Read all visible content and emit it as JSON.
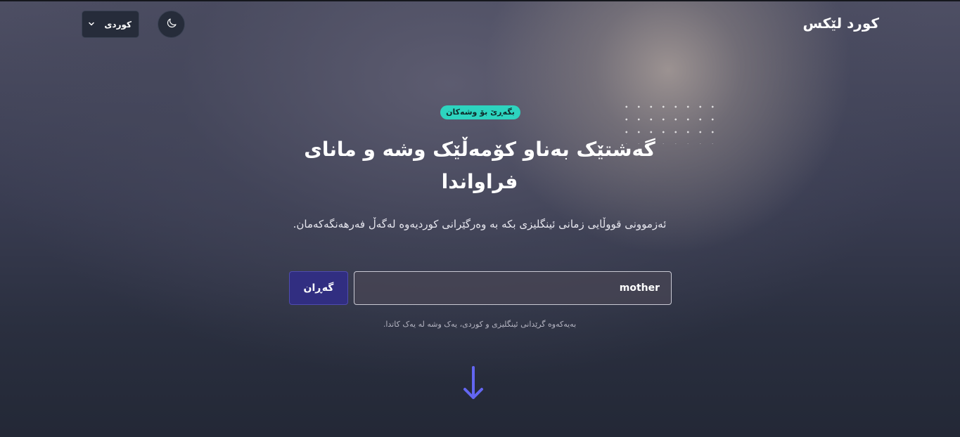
{
  "header": {
    "brand": "کورد لێکس",
    "language_select": {
      "selected": "کوردی",
      "icon": "chevron-down-icon"
    },
    "theme_toggle": {
      "icon": "moon-icon"
    }
  },
  "hero": {
    "badge": "بگەڕێ بۆ وشەکان",
    "headline_line1": "گەشتێک بەناو کۆمەڵێک وشە و مانای",
    "headline_line2": "فراواندا",
    "subtitle": "ئەزموونی قووڵایی زمانی ئینگلیزی بکە بە وەرگێرانی کوردیەوە لەگەڵ فەرهەنگەکەمان."
  },
  "search": {
    "value": "mother",
    "button_label": "گەڕان",
    "hint": "بەیەکەوە گرێدانی ئینگلیزی و کوردی، یەک وشە لە یەک کاتدا."
  },
  "scroll": {
    "icon": "arrow-down-icon"
  },
  "colors": {
    "accent_badge": "#2dd4bf",
    "button": "#312e81",
    "arrow": "#6366f1"
  }
}
